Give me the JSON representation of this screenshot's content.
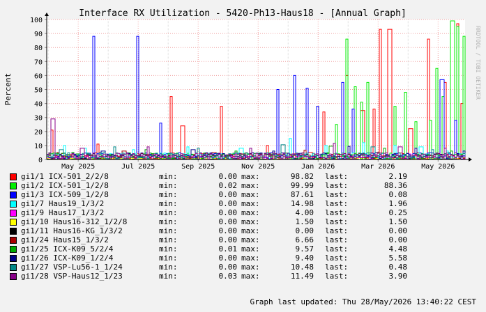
{
  "chart_data": {
    "type": "line",
    "title": "Interface RX Utilization - 5420-Ph13-Haus18 - [Annual Graph]",
    "ylabel": "Percent",
    "watermark": "RRDTOOL / TOBI OETIKER",
    "ylim": [
      0,
      100
    ],
    "y_ticks": [
      "0",
      "10",
      "20",
      "30",
      "40",
      "50",
      "60",
      "70",
      "80",
      "90",
      "100"
    ],
    "x_ticks": [
      "May 2025",
      "Jul 2025",
      "Sep 2025",
      "Nov 2025",
      "Jan 2026",
      "Mar 2026",
      "May 2026"
    ],
    "x_tick_months": [
      1,
      3,
      5,
      7,
      9,
      11,
      13
    ],
    "x_range_months": [
      -0.05,
      13.9
    ],
    "grid": true,
    "series": [
      {
        "name": "gi1/1 ICX-501_2/2/8",
        "color": "#ff0000",
        "min": "0.00",
        "max": "98.82",
        "last": "2.19",
        "spikes": [
          [
            0.06,
            21
          ],
          [
            1.6,
            11
          ],
          [
            3.0,
            2
          ],
          [
            4.08,
            45
          ],
          [
            4.45,
            24
          ],
          [
            5.72,
            38
          ],
          [
            7.25,
            10
          ],
          [
            8.7,
            5
          ],
          [
            9.15,
            34
          ],
          [
            9.95,
            60
          ],
          [
            10.45,
            35
          ],
          [
            10.85,
            36
          ],
          [
            11.05,
            93
          ],
          [
            11.35,
            93
          ],
          [
            12.05,
            22
          ],
          [
            12.62,
            86
          ],
          [
            13.22,
            55
          ],
          [
            13.6,
            97
          ],
          [
            13.78,
            40
          ]
        ]
      },
      {
        "name": "gi1/2 ICX-501_1/2/8",
        "color": "#00ee00",
        "min": "0.02",
        "max": "99.99",
        "last": "88.36",
        "spikes": [
          [
            9.6,
            25
          ],
          [
            9.9,
            86
          ],
          [
            10.2,
            52
          ],
          [
            10.4,
            41
          ],
          [
            10.65,
            55
          ],
          [
            11.55,
            38
          ],
          [
            11.85,
            48
          ],
          [
            12.25,
            27
          ],
          [
            12.7,
            28
          ],
          [
            12.95,
            65
          ],
          [
            13.15,
            45
          ],
          [
            13.45,
            99
          ],
          [
            13.65,
            95
          ],
          [
            13.82,
            88
          ]
        ]
      },
      {
        "name": "gi1/3 ICX-509_1/2/8",
        "color": "#0000ff",
        "min": "0.00",
        "max": "87.61",
        "last": "0.08",
        "spikes": [
          [
            1.5,
            88
          ],
          [
            2.97,
            88
          ],
          [
            3.72,
            26
          ],
          [
            7.65,
            50
          ],
          [
            8.18,
            60
          ],
          [
            8.6,
            51
          ],
          [
            8.95,
            38
          ],
          [
            9.8,
            55
          ],
          [
            10.15,
            36
          ],
          [
            13.1,
            57
          ],
          [
            13.55,
            28
          ]
        ]
      },
      {
        "name": "gi1/7 Haus19_1/3/2",
        "color": "#00ffff",
        "min": "0.00",
        "max": "14.98",
        "last": "1.96",
        "spikes": [
          [
            0.5,
            10
          ],
          [
            1.2,
            8
          ],
          [
            2.8,
            7
          ],
          [
            4.6,
            9
          ],
          [
            6.4,
            8
          ],
          [
            8.02,
            15
          ],
          [
            9.2,
            10
          ],
          [
            10.5,
            12
          ],
          [
            11.5,
            10
          ],
          [
            12.4,
            9
          ],
          [
            13.3,
            6
          ]
        ]
      },
      {
        "name": "gi1/9 Haus17_1/3/2",
        "color": "#ff00ff",
        "min": "0.00",
        "max": "4.00",
        "last": "0.25",
        "spikes": [
          [
            1.0,
            3
          ],
          [
            3.5,
            4
          ],
          [
            6.0,
            3
          ],
          [
            9.0,
            3
          ],
          [
            12.0,
            4
          ],
          [
            13.5,
            2
          ]
        ]
      },
      {
        "name": "gi1/10 Haus16-312_1/2/8",
        "color": "#ffff00",
        "min": "0.00",
        "max": "1.50",
        "last": "1.50",
        "spikes": [
          [
            4.0,
            1.5
          ],
          [
            13.8,
            1.5
          ]
        ]
      },
      {
        "name": "gi1/11 Haus16-KG_1/3/2",
        "color": "#000000",
        "min": "0.00",
        "max": "0.00",
        "last": "0.00",
        "spikes": []
      },
      {
        "name": "gi1/24 Haus15_1/3/2",
        "color": "#aa0000",
        "min": "0.00",
        "max": "6.66",
        "last": "0.00",
        "spikes": [
          [
            0.3,
            5
          ],
          [
            2.5,
            6
          ],
          [
            5.5,
            5
          ],
          [
            8.5,
            6.6
          ],
          [
            11.0,
            5
          ],
          [
            13.0,
            4
          ]
        ]
      },
      {
        "name": "gi1/25 ICX-K09_5/2/4",
        "color": "#00aa00",
        "min": "0.01",
        "max": "9.57",
        "last": "4.48",
        "spikes": [
          [
            0.8,
            5
          ],
          [
            3.2,
            7
          ],
          [
            6.2,
            6
          ],
          [
            9.4,
            9.5
          ],
          [
            11.2,
            8
          ],
          [
            13.4,
            6
          ]
        ]
      },
      {
        "name": "gi1/26 ICX-K09_1/2/4",
        "color": "#000088",
        "min": "0.00",
        "max": "9.40",
        "last": "5.58",
        "spikes": [
          [
            1.8,
            6
          ],
          [
            4.8,
            7
          ],
          [
            7.5,
            6
          ],
          [
            10.0,
            9.4
          ],
          [
            12.2,
            8
          ],
          [
            13.85,
            6
          ]
        ]
      },
      {
        "name": "gi1/27 VSP-Lu56-1_1/24",
        "color": "#008888",
        "min": "0.00",
        "max": "10.48",
        "last": "0.48",
        "spikes": [
          [
            0.4,
            7
          ],
          [
            2.2,
            9
          ],
          [
            5.0,
            8
          ],
          [
            7.8,
            10.5
          ],
          [
            10.8,
            9
          ],
          [
            12.8,
            7
          ]
        ]
      },
      {
        "name": "gi1/28 VSP-Haus12_1/23",
        "color": "#880088",
        "min": "0.03",
        "max": "11.49",
        "last": "3.90",
        "spikes": [
          [
            0.12,
            29
          ],
          [
            1.1,
            8
          ],
          [
            3.3,
            9
          ],
          [
            6.7,
            8
          ],
          [
            9.5,
            11.5
          ],
          [
            11.7,
            9
          ],
          [
            13.2,
            8
          ]
        ]
      }
    ]
  },
  "legend": {
    "min_label": "min:",
    "max_label": "max:",
    "last_label": "last:"
  },
  "footer": "Graph last updated: Thu 28/May/2026 13:40:22 CEST"
}
